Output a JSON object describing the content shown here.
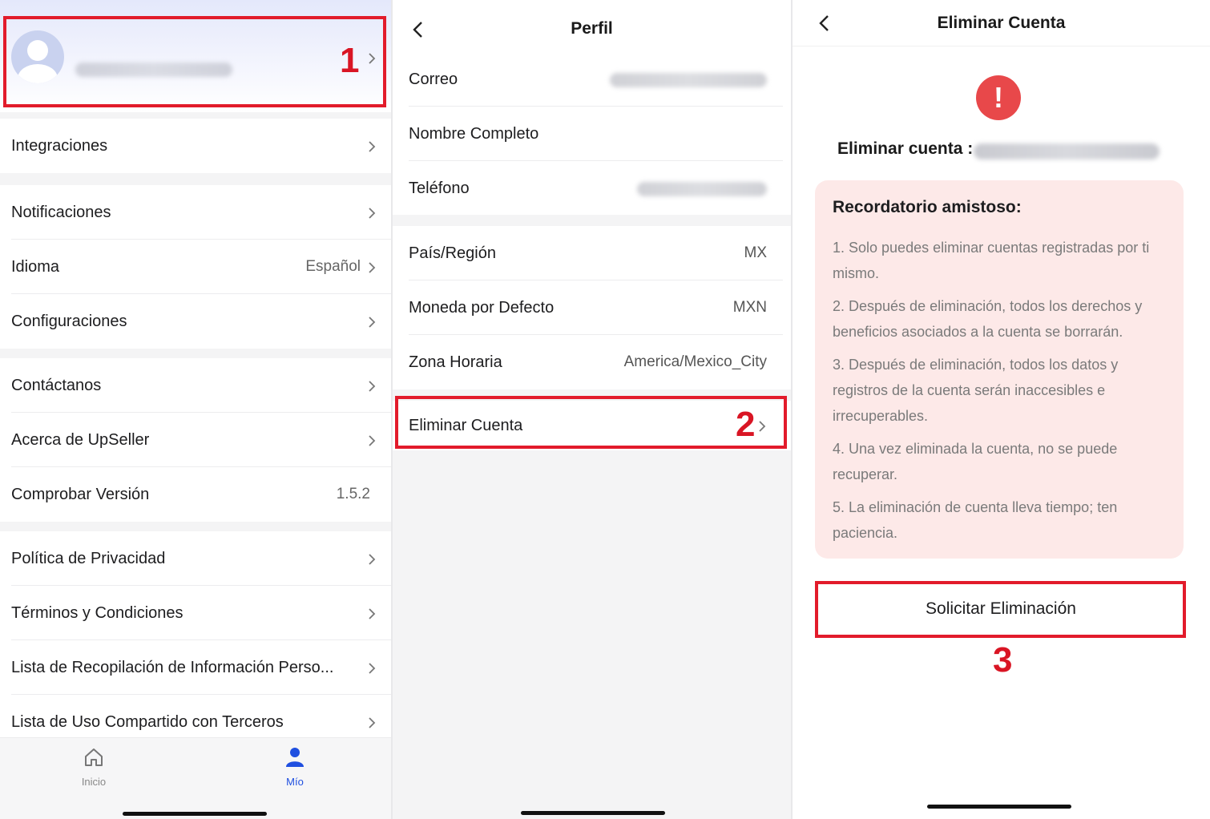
{
  "panel1": {
    "step_number": "1",
    "menu_groups": [
      [
        {
          "label": "Integraciones"
        }
      ],
      [
        {
          "label": "Notificaciones"
        },
        {
          "label": "Idioma",
          "value": "Español"
        },
        {
          "label": "Configuraciones"
        }
      ],
      [
        {
          "label": "Contáctanos"
        },
        {
          "label": "Acerca de UpSeller"
        },
        {
          "label": "Comprobar Versión",
          "value": "1.5.2"
        }
      ],
      [
        {
          "label": "Política de Privacidad"
        },
        {
          "label": "Términos y Condiciones"
        },
        {
          "label": "Lista de Recopilación de Información Perso..."
        },
        {
          "label": "Lista de Uso Compartido con Terceros"
        }
      ]
    ],
    "tabbar": {
      "home_label": "Inicio",
      "mine_label": "Mío"
    }
  },
  "panel2": {
    "title": "Perfil",
    "correo_label": "Correo",
    "nombre_label": "Nombre Completo",
    "telefono_label": "Teléfono",
    "pais_label": "País/Región",
    "pais_value": "MX",
    "moneda_label": "Moneda por Defecto",
    "moneda_value": "MXN",
    "zona_label": "Zona Horaria",
    "zona_value": "America/Mexico_City",
    "eliminar_label": "Eliminar Cuenta",
    "step_number": "2"
  },
  "panel3": {
    "title": "Eliminar Cuenta",
    "alert_glyph": "!",
    "delete_heading": "Eliminar cuenta :",
    "reminder_title": "Recordatorio amistoso:",
    "reminders": [
      "1. Solo puedes eliminar cuentas registradas por ti mismo.",
      "2. Después de eliminación, todos los derechos y beneficios asociados a la cuenta se borrarán.",
      "3. Después de eliminación, todos los datos y registros de la cuenta serán inaccesibles e irrecuperables.",
      "4. Una vez eliminada la cuenta, no se puede recuperar.",
      "5. La eliminación de cuenta lleva tiempo; ten paciencia."
    ],
    "button_label": "Solicitar Eliminación",
    "step_number": "3"
  },
  "colors": {
    "annotation_red": "#e21b2b",
    "active_tab_blue": "#1f4fe0",
    "alert_red": "#e8484a",
    "reminder_bg": "#fde9e8"
  }
}
